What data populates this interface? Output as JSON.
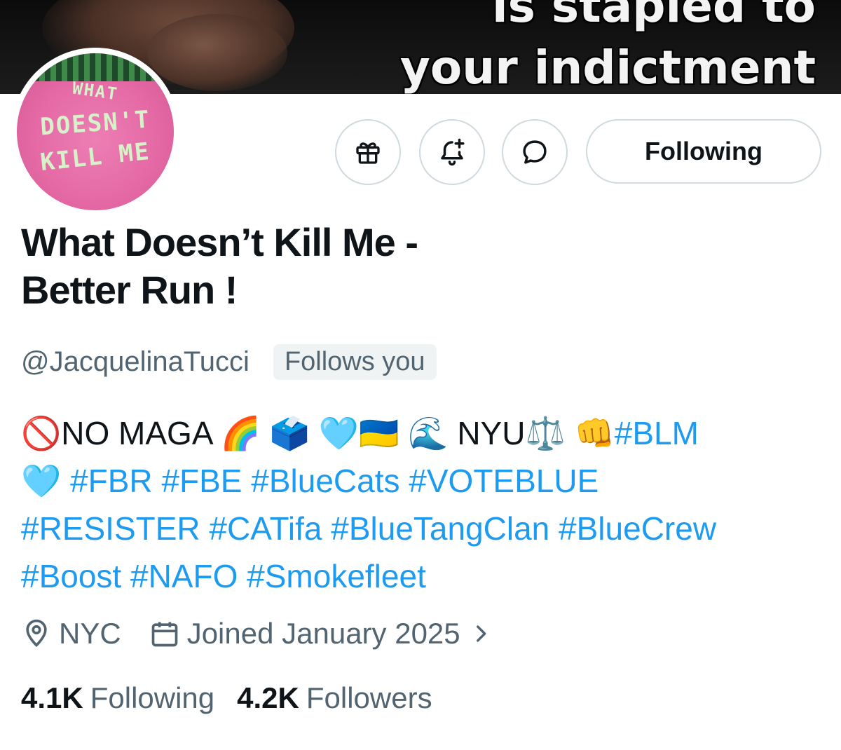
{
  "banner": {
    "overlay_line1": "is stapled to",
    "overlay_line2": "your indictment"
  },
  "avatar": {
    "text_line1": "WHAT",
    "text_line2": "DOESN'T",
    "text_line3": "KILL ME"
  },
  "actions": {
    "gift_icon": "gift-icon",
    "notify_icon": "bell-plus-icon",
    "message_icon": "message-bubble-icon",
    "follow_label": "Following"
  },
  "profile": {
    "name_line1": "What Doesn’t Kill Me -",
    "name_line2": "Better Run !",
    "handle": "@JacquelinaTucci",
    "follows_you": "Follows you"
  },
  "bio": {
    "no_sign": "🚫",
    "no_maga": "NO MAGA",
    "emoji_rainbow": "🌈",
    "emoji_ballot": "🗳️",
    "emoji_heart": "🩵",
    "emoji_flag": "🇺🇦",
    "emoji_wave": "🌊",
    "nyu": "NYU",
    "emoji_scales": "⚖️",
    "emoji_fist": "👊",
    "tag_blm": "#BLM",
    "emoji_heart2": "🩵",
    "tag_fbr": "#FBR",
    "tag_fbe": "#FBE",
    "tag_bluecats": "#BlueCats",
    "tag_voteblue": "#VOTEBLUE",
    "tag_resister": "#RESISTER",
    "tag_catifa": "#CATifa",
    "tag_bluetangclan": "#BlueTangClan",
    "tag_bluecrew": "#BlueCrew",
    "tag_boost": "#Boost",
    "tag_nafo": "#NAFO",
    "tag_smokefleet": "#Smokefleet"
  },
  "meta": {
    "location": "NYC",
    "joined": "Joined January 2025",
    "location_icon": "location-pin-icon",
    "calendar_icon": "calendar-icon"
  },
  "stats": {
    "following_count": "4.1K",
    "following_label": "Following",
    "followers_count": "4.2K",
    "followers_label": "Followers"
  },
  "colors": {
    "link_blue": "#1d9bf0",
    "secondary_text": "#536471",
    "border": "#cfd9de"
  }
}
